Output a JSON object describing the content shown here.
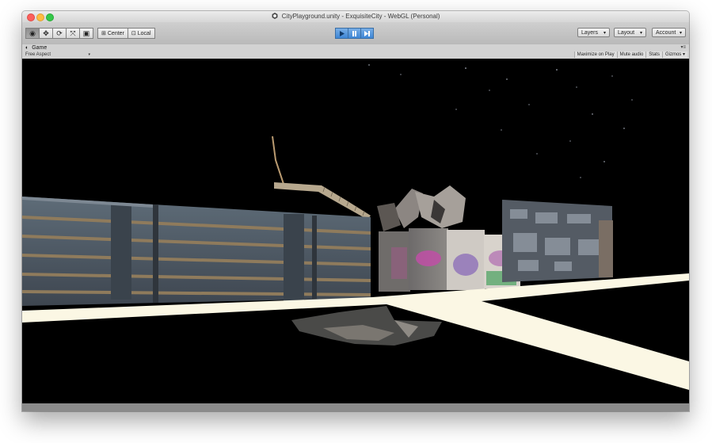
{
  "window": {
    "title": "CityPlayground.unity - ExquisiteCity - WebGL (Personal)"
  },
  "toolbar": {
    "tools": [
      {
        "name": "hand-tool",
        "icon": "hand-icon"
      },
      {
        "name": "move-tool",
        "icon": "move-arrows-icon"
      },
      {
        "name": "rotate-tool",
        "icon": "rotate-icon"
      },
      {
        "name": "scale-tool",
        "icon": "scale-icon"
      },
      {
        "name": "rect-tool",
        "icon": "rect-transform-icon"
      }
    ],
    "pivot_label": "Center",
    "space_label": "Local",
    "playback": [
      "play-icon",
      "pause-icon",
      "step-icon"
    ],
    "layers_label": "Layers",
    "layout_label": "Layout",
    "account_label": "Account"
  },
  "game_view": {
    "tab_label": "Game",
    "aspect_label": "Free Aspect",
    "maximize_label": "Maximize on Play",
    "mute_label": "Mute audio",
    "stats_label": "Stats",
    "gizmos_label": "Gizmos"
  },
  "colors": {
    "play_accent": "#3e86d6",
    "viewport_bg": "#000000",
    "ground_plane": "#fbf7e4"
  }
}
